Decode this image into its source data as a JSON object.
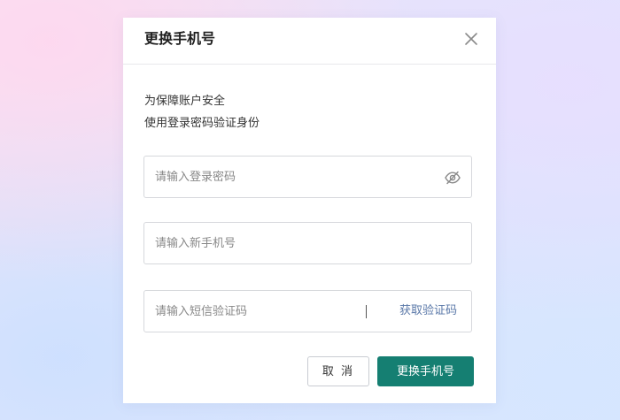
{
  "dialog": {
    "title": "更换手机号",
    "close_icon": "close-icon",
    "notice": {
      "line1": "为保障账户安全",
      "line2": "使用登录密码验证身份"
    },
    "password_field": {
      "placeholder": "请输入登录密码",
      "value": "",
      "toggle_icon": "eye-slash-icon"
    },
    "phone_field": {
      "placeholder": "请输入新手机号",
      "value": ""
    },
    "code_field": {
      "placeholder": "请输入短信验证码",
      "value": "",
      "get_code_label": "获取验证码"
    },
    "buttons": {
      "cancel_label": "取 消",
      "confirm_label": "更换手机号"
    }
  },
  "colors": {
    "primary": "#157f72",
    "link": "#5a78a8",
    "border": "#d6d8dc",
    "text": "#333333",
    "placeholder": "#888888"
  }
}
